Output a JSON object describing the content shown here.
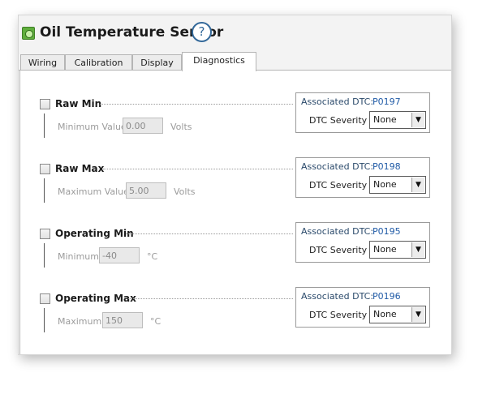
{
  "window": {
    "title": "Oil Temperature Sensor",
    "help_glyph": "?"
  },
  "tabs": [
    {
      "label": "Wiring",
      "active": false
    },
    {
      "label": "Calibration",
      "active": false
    },
    {
      "label": "Display",
      "active": false
    },
    {
      "label": "Diagnostics",
      "active": true
    }
  ],
  "sections": [
    {
      "title": "Raw Min",
      "checked": false,
      "field_label": "Minimum Value",
      "field_value": "0.00",
      "unit": "Volts",
      "dtc_label": "Associated DTC:",
      "dtc_code": "P0197",
      "severity_label": "DTC Severity",
      "severity_value": "None"
    },
    {
      "title": "Raw Max",
      "checked": false,
      "field_label": "Maximum Value",
      "field_value": "5.00",
      "unit": "Volts",
      "dtc_label": "Associated DTC:",
      "dtc_code": "P0198",
      "severity_label": "DTC Severity",
      "severity_value": "None"
    },
    {
      "title": "Operating Min",
      "checked": false,
      "field_label": "Minimum",
      "field_value": "-40",
      "unit": "°C",
      "dtc_label": "Associated DTC:",
      "dtc_code": "P0195",
      "severity_label": "DTC Severity",
      "severity_value": "None"
    },
    {
      "title": "Operating Max",
      "checked": false,
      "field_label": "Maximum",
      "field_value": "150",
      "unit": "°C",
      "dtc_label": "Associated DTC:",
      "dtc_code": "P0196",
      "severity_label": "DTC Severity",
      "severity_value": "None"
    }
  ],
  "icons": {
    "app": "sensor-icon",
    "dropdown": "chevron-down-icon"
  },
  "colors": {
    "accent": "#1f5aa6",
    "help": "#34699a",
    "app_icon": "#5fae3c"
  }
}
